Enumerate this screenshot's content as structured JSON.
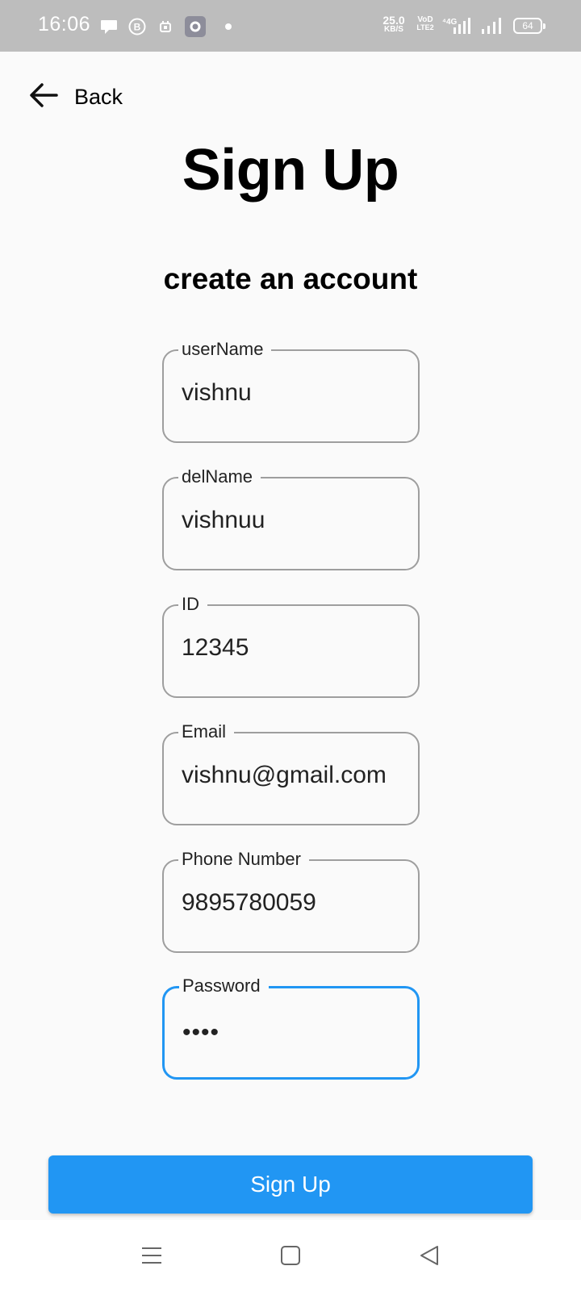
{
  "status_bar": {
    "time": "16:06",
    "net_speed_value": "25.0",
    "net_speed_unit": "KB/S",
    "volte_top": "VoD",
    "volte_bottom": "LTE2",
    "battery": "64",
    "icons": [
      "chat-bubble-icon",
      "b-circle-icon",
      "calendar-icon",
      "settings-app-icon",
      "notification-dot-icon",
      "signal-4g-icon",
      "signal-icon",
      "battery-icon"
    ]
  },
  "header": {
    "back_label": "Back",
    "title": "Sign Up",
    "subtitle": "create an account"
  },
  "form": {
    "username": {
      "label": "userName",
      "value": "vishnu"
    },
    "delname": {
      "label": "delName",
      "value": "vishnuu"
    },
    "id": {
      "label": "ID",
      "value": "12345"
    },
    "email": {
      "label": "Email",
      "value": "vishnu@gmail.com"
    },
    "phone": {
      "label": "Phone Number",
      "value": "9895780059"
    },
    "password": {
      "label": "Password",
      "masked_value": "••••"
    }
  },
  "actions": {
    "signup_label": "Sign Up"
  },
  "colors": {
    "accent": "#2196f3",
    "status_bar": "#bdbdbd",
    "background": "#fafafa",
    "border": "#9e9e9e"
  },
  "nav_bar": {
    "icons": [
      "menu-icon",
      "home-square-icon",
      "back-triangle-icon"
    ]
  }
}
